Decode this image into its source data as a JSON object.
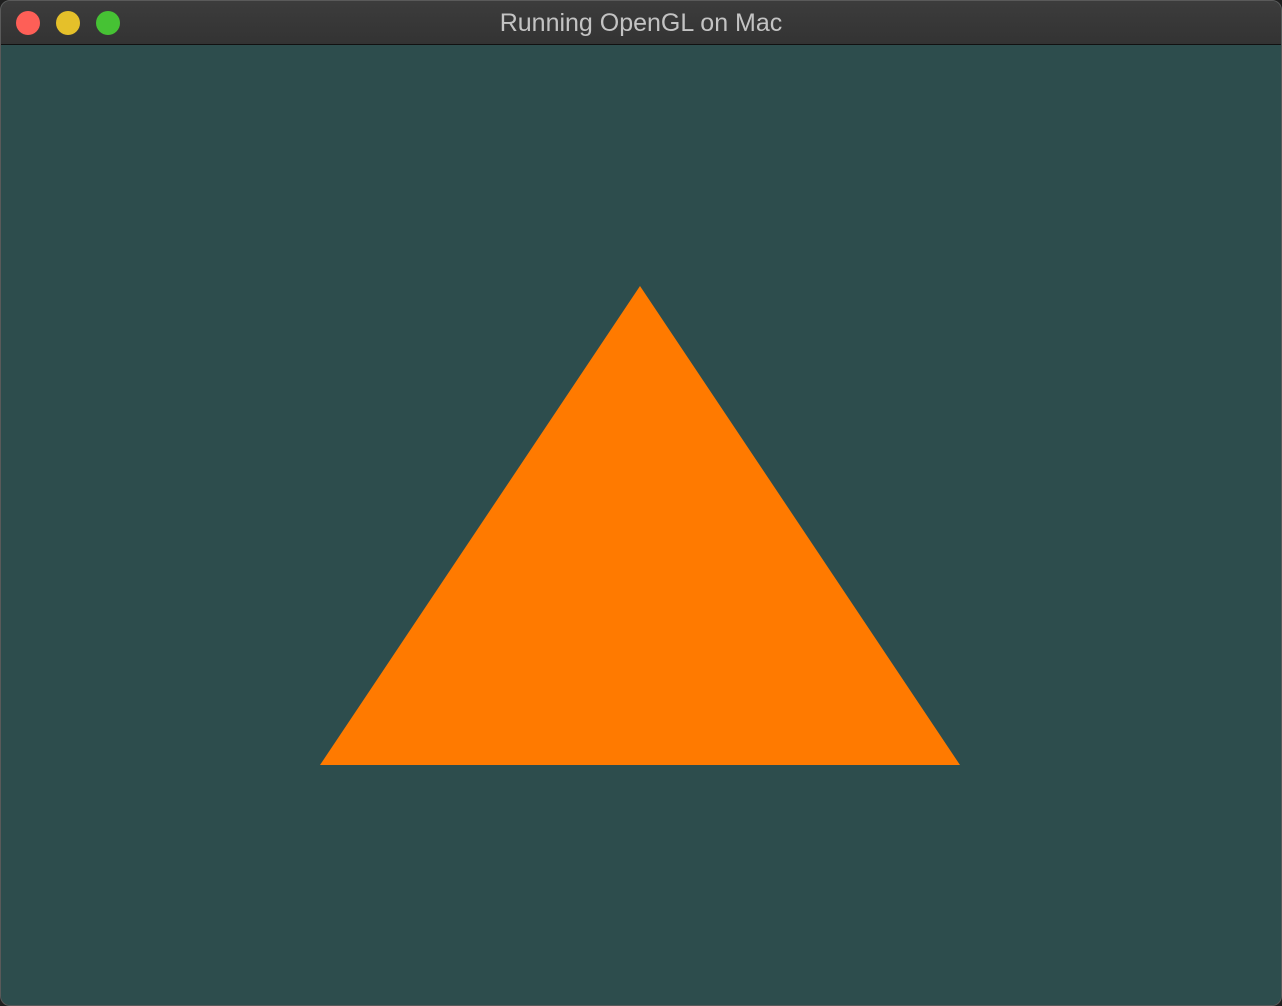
{
  "window": {
    "title": "Running OpenGL on Mac",
    "controls": {
      "close": {
        "icon": "close-icon",
        "color": "#fe5f57"
      },
      "minimize": {
        "icon": "minimize-icon",
        "color": "#e5c02a"
      },
      "zoom": {
        "icon": "zoom-icon",
        "color": "#46c234"
      }
    }
  },
  "scene": {
    "clear_color": "#2d4d4d",
    "shape": "triangle",
    "fill_color": "#ff7a00"
  }
}
